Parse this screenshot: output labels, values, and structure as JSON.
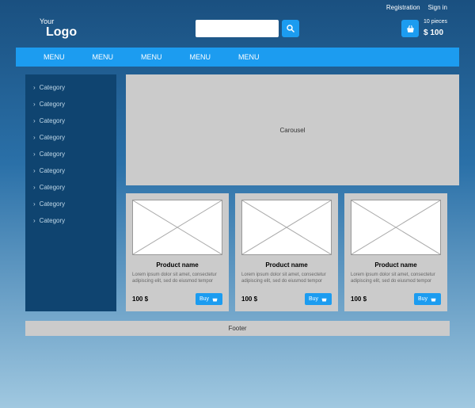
{
  "top": {
    "registration": "Registration",
    "signin": "Sign in"
  },
  "logo": {
    "your": "Your",
    "main": "Logo"
  },
  "search": {
    "placeholder": ""
  },
  "cart": {
    "pieces": "10 pieces",
    "total": "$ 100"
  },
  "nav": [
    "MENU",
    "MENU",
    "MENU",
    "MENU",
    "MENU"
  ],
  "sidebar": [
    "Category",
    "Category",
    "Category",
    "Category",
    "Category",
    "Category",
    "Category",
    "Category",
    "Category"
  ],
  "carousel": "Carousel",
  "products": [
    {
      "name": "Product name",
      "desc": "Lorem ipsum dolor sit amet, consectetur adipiscing elit, sed do eiusmod tempor",
      "price": "100 $",
      "buy": "Buy"
    },
    {
      "name": "Product name",
      "desc": "Lorem ipsum dolor sit amet, consectetur adipiscing elit, sed do eiusmod tempor",
      "price": "100 $",
      "buy": "Buy"
    },
    {
      "name": "Product name",
      "desc": "Lorem ipsum dolor sit amet, consectetur adipiscing elit, sed do eiusmod tempor",
      "price": "100 $",
      "buy": "Buy"
    }
  ],
  "footer": "Footer"
}
